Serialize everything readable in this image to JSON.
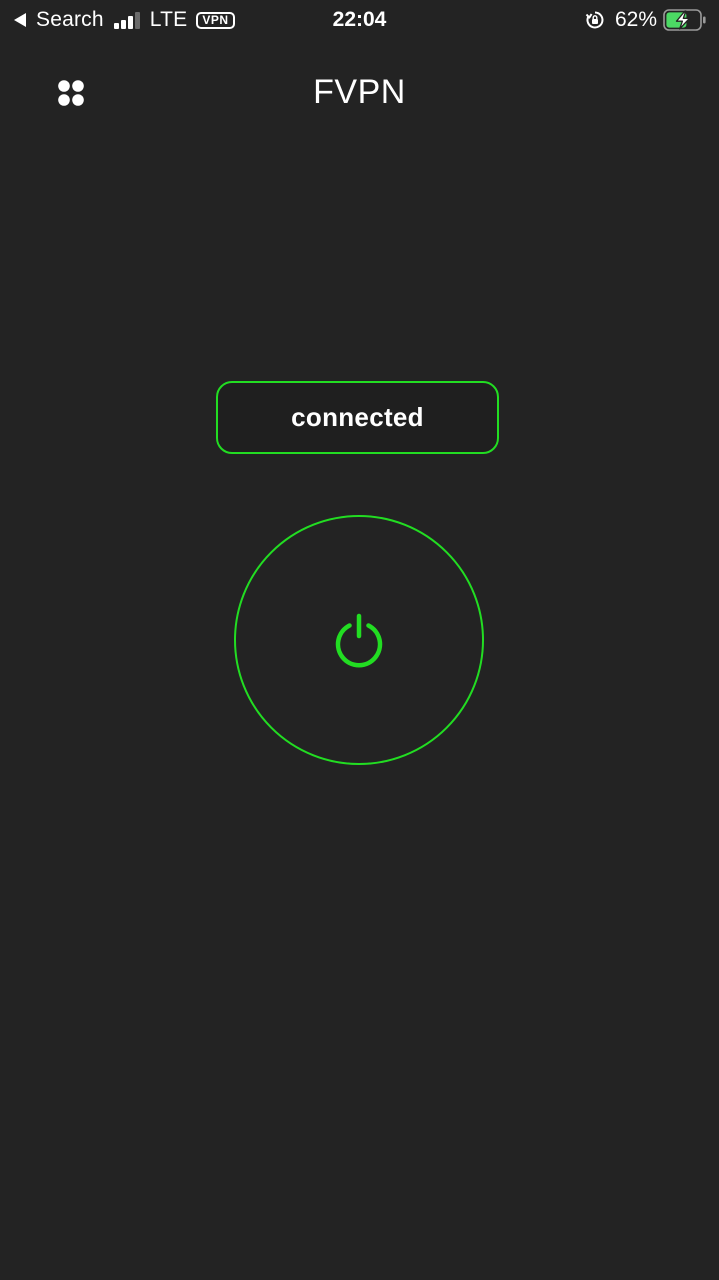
{
  "status_bar": {
    "back_label": "Search",
    "network": "LTE",
    "vpn_badge": "VPN",
    "time": "22:04",
    "battery_percent": "62%",
    "signal_bars_active": 3,
    "signal_bars_total": 4,
    "battery_level": 0.62,
    "battery_charging": true,
    "battery_color": "#4cd964"
  },
  "header": {
    "title": "FVPN",
    "menu_icon": "grid-dots-icon"
  },
  "connection": {
    "status_label": "connected",
    "power_icon": "power-icon",
    "accent_color": "#22dd22"
  },
  "colors": {
    "background": "#232323",
    "text": "#ffffff",
    "accent": "#22dd22"
  }
}
